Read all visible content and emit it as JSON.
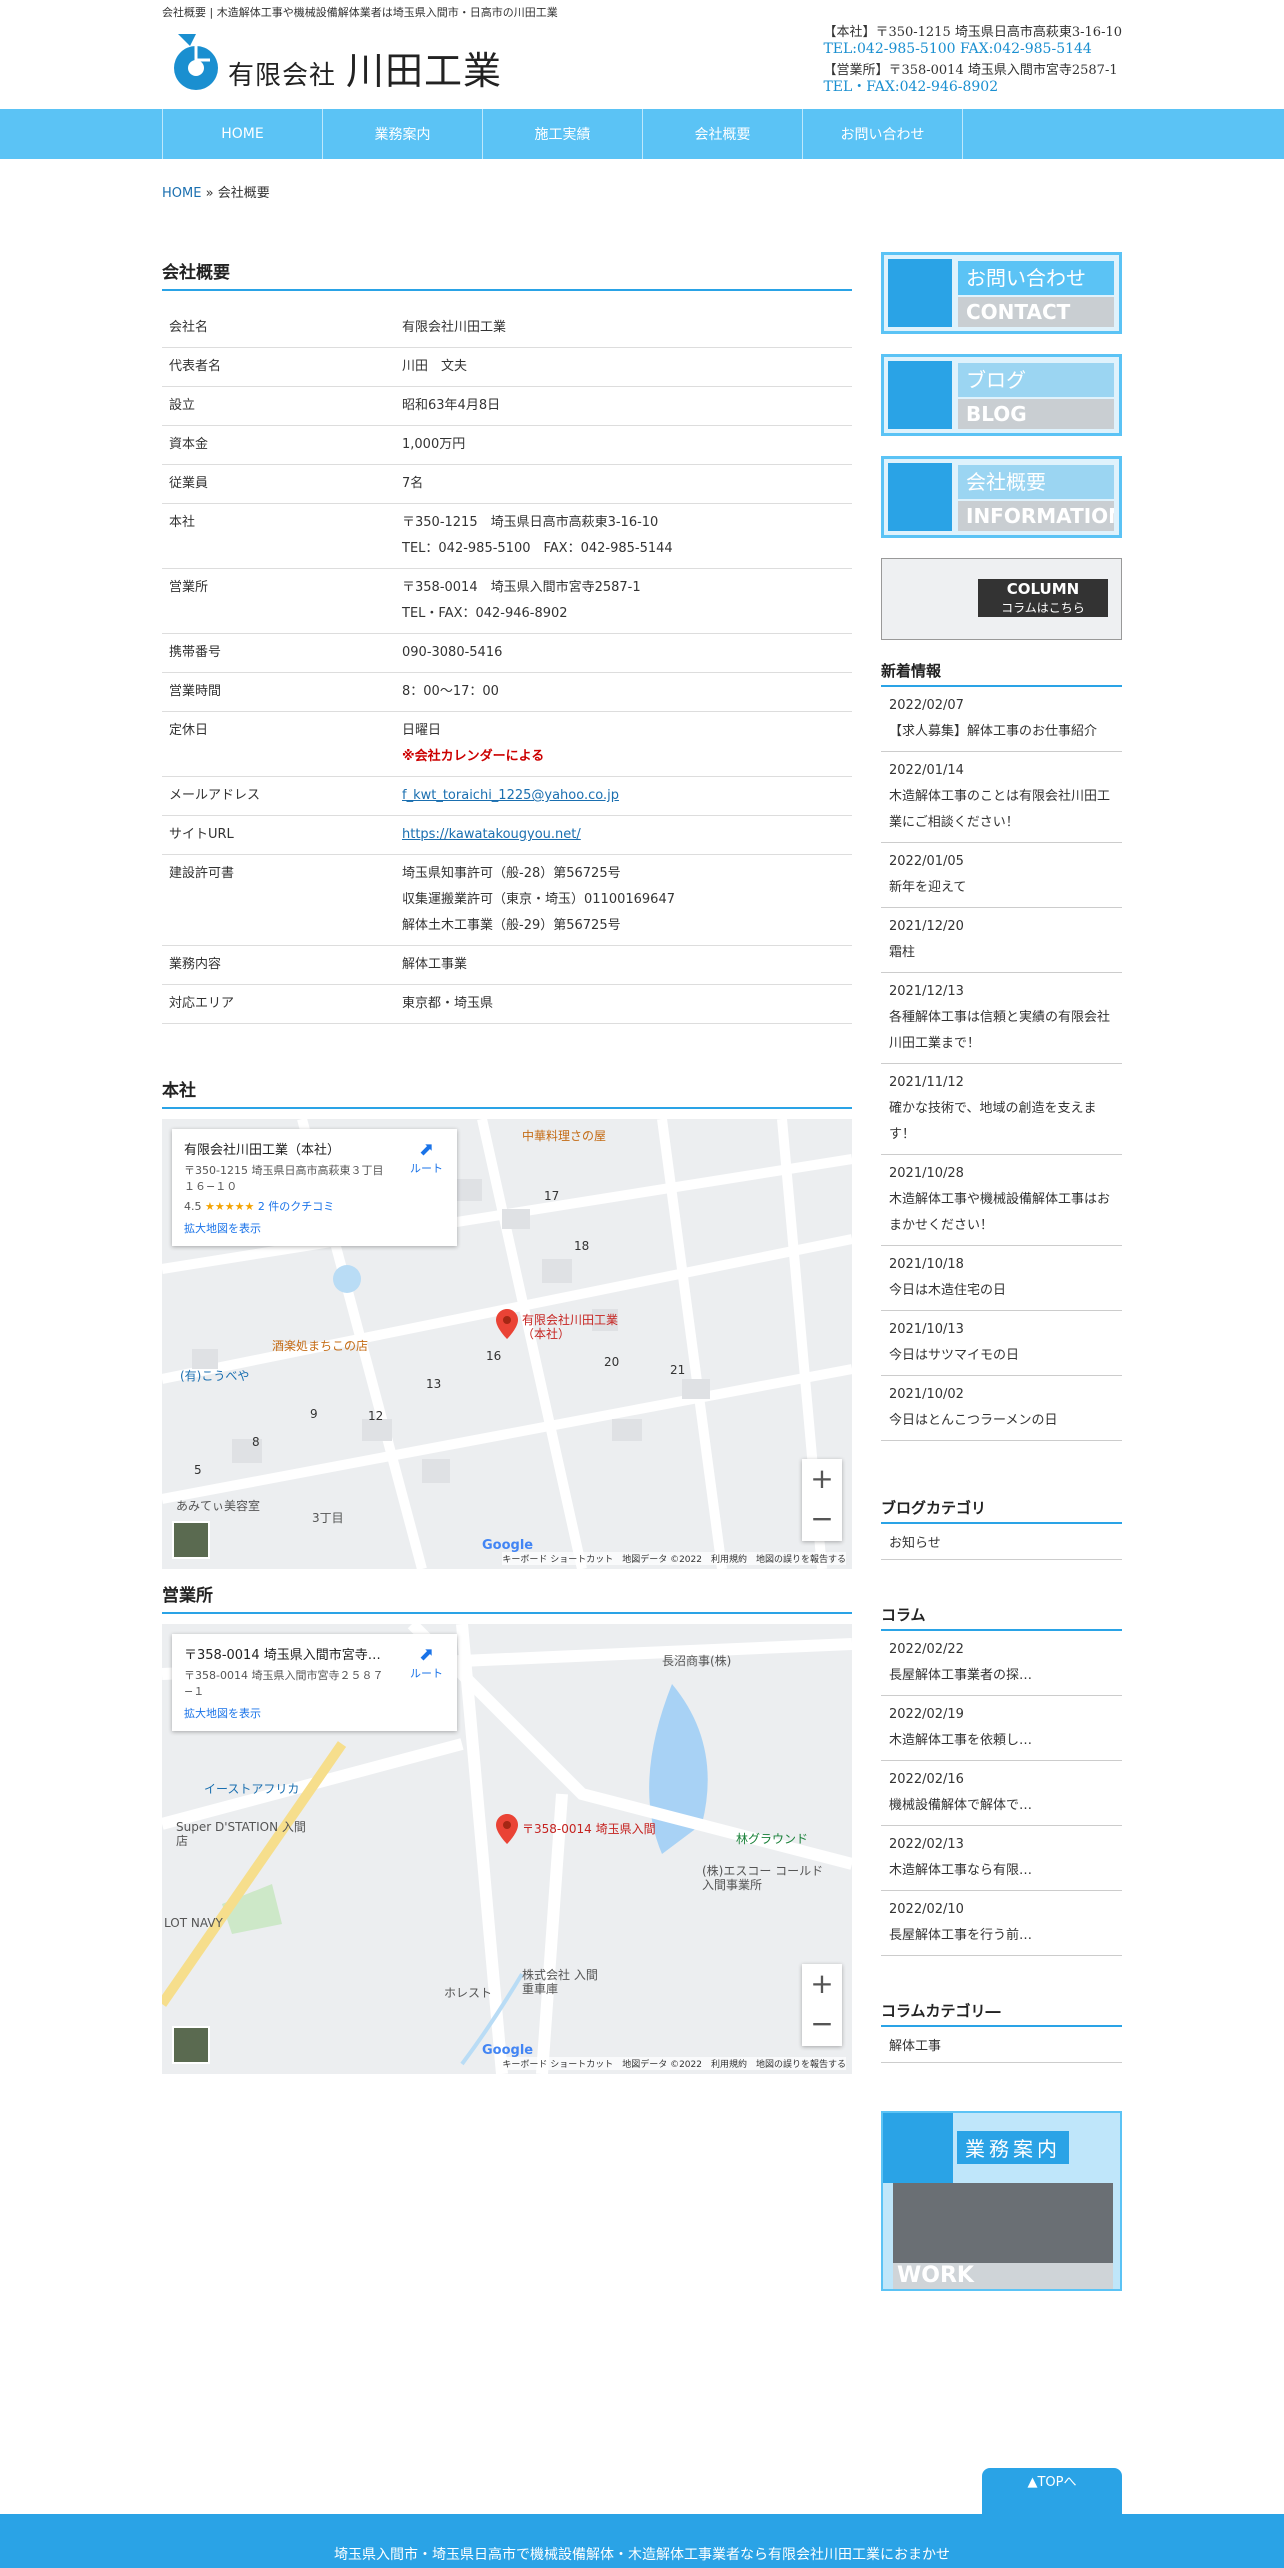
{
  "header": {
    "tagline": "会社概要 | 木造解体工事や機械設備解体業者は埼玉県入間市・日高市の川田工業",
    "logo_prefix": "有限会社",
    "logo_name": "川田工業",
    "hq_address": "【本社】〒350-1215 埼玉県日高市高萩東3-16-10",
    "hq_tel": "TEL:042-985-5100  FAX:042-985-5144",
    "office_address": "【営業所】〒358-0014 埼玉県入間市宮寺2587-1",
    "office_tel": "TEL・FAX:042-946-8902"
  },
  "nav": [
    "HOME",
    "業務案内",
    "施工実績",
    "会社概要",
    "お問い合わせ"
  ],
  "breadcrumb": {
    "home": "HOME",
    "sep": "»",
    "current": "会社概要"
  },
  "main": {
    "title": "会社概要",
    "rows": [
      {
        "k": "会社名",
        "v": [
          "有限会社川田工業"
        ]
      },
      {
        "k": "代表者名",
        "v": [
          "川田　文夫"
        ]
      },
      {
        "k": "設立",
        "v": [
          "昭和63年4月8日"
        ]
      },
      {
        "k": "資本金",
        "v": [
          "1,000万円"
        ]
      },
      {
        "k": "従業員",
        "v": [
          "7名"
        ]
      },
      {
        "k": "本社",
        "v": [
          "〒350-1215　埼玉県日高市高萩東3-16-10",
          "TEL：042-985-5100　FAX：042-985-5144"
        ]
      },
      {
        "k": "営業所",
        "v": [
          "〒358-0014　埼玉県入間市宮寺2587-1",
          "TEL・FAX：042-946-8902"
        ]
      },
      {
        "k": "携帯番号",
        "v": [
          "090-3080-5416"
        ]
      },
      {
        "k": "営業時間",
        "v": [
          "8：00～17：00"
        ]
      },
      {
        "k": "定休日",
        "v": [
          "日曜日"
        ],
        "note": "※会社カレンダーによる"
      },
      {
        "k": "メールアドレス",
        "v": [
          "f_kwt_toraichi_1225@yahoo.co.jp"
        ],
        "link": true
      },
      {
        "k": "サイトURL",
        "v": [
          "https://kawatakougyou.net/"
        ],
        "link": true
      },
      {
        "k": "建設許可書",
        "v": [
          "埼玉県知事許可（般-28）第56725号",
          "収集運搬業許可（東京・埼玉）01100169647",
          "解体土木工事業（般-29）第56725号"
        ]
      },
      {
        "k": "業務内容",
        "v": [
          "解体工事業"
        ]
      },
      {
        "k": "対応エリア",
        "v": [
          "東京都・埼玉県"
        ]
      }
    ],
    "map1": {
      "title": "本社",
      "card_title": "有限会社川田工業（本社）",
      "card_addr": "〒350-1215 埼玉県日高市高萩東３丁目１６−１０",
      "rating": "4.5",
      "stars": "★★★★★",
      "reviews": "2 件のクチコミ",
      "enlarge": "拡大地図を表示",
      "route": "ルート",
      "pin_label": "有限会社川田工業（本社）",
      "places": [
        "中華料理さの屋",
        "(有)こうべや",
        "酒楽処まちこの店",
        "あみてぃ美容室",
        "3丁目"
      ],
      "blocks": [
        "17",
        "18",
        "16",
        "20",
        "21",
        "13",
        "12",
        "9",
        "8",
        "5"
      ],
      "footer": "キーボード ショートカット　地図データ ©2022　利用規約　地図の誤りを報告する",
      "google": "Google"
    },
    "map2": {
      "title": "営業所",
      "card_title": "〒358-0014 埼玉県入間市宮寺…",
      "card_addr": "〒358-0014 埼玉県入間市宮寺２５８７−１",
      "enlarge": "拡大地図を表示",
      "route": "ルート",
      "pin_label": "〒358-0014 埼玉県入間",
      "places": [
        "長沼商事(株)",
        "イーストアフリカ",
        "Super D'STATION 入間店",
        "(株)エスコー コールド 入間事業所",
        "林グラウンド",
        "株式会社 入間重車庫",
        "ホレスト",
        "LOT NAVY"
      ],
      "footer": "キーボード ショートカット　地図データ ©2022　利用規約　地図の誤りを報告する",
      "google": "Google"
    }
  },
  "sidebar": {
    "banners": [
      {
        "jp": "お問い合わせ",
        "en": "CONTACT"
      },
      {
        "jp": "ブログ",
        "en": "BLOG"
      },
      {
        "jp": "会社概要",
        "en": "INFORMATION"
      },
      {
        "jp": "コラムはこちら",
        "en": "COLUMN"
      }
    ],
    "news_title": "新着情報",
    "news": [
      {
        "date": "2022/02/07",
        "text": "【求人募集】解体工事のお仕事紹介"
      },
      {
        "date": "2022/01/14",
        "text": "木造解体工事のことは有限会社川田工業にご相談ください！"
      },
      {
        "date": "2022/01/05",
        "text": "新年を迎えて"
      },
      {
        "date": "2021/12/20",
        "text": "霜柱"
      },
      {
        "date": "2021/12/13",
        "text": "各種解体工事は信頼と実績の有限会社川田工業まで！"
      },
      {
        "date": "2021/11/12",
        "text": "確かな技術で、地域の創造を支えます！"
      },
      {
        "date": "2021/10/28",
        "text": "木造解体工事や機械設備解体工事はおまかせください！"
      },
      {
        "date": "2021/10/18",
        "text": "今日は木造住宅の日"
      },
      {
        "date": "2021/10/13",
        "text": "今日はサツマイモの日"
      },
      {
        "date": "2021/10/02",
        "text": "今日はとんこつラーメンの日"
      }
    ],
    "blogcat_title": "ブログカテゴリ",
    "blogcat": [
      "お知らせ"
    ],
    "column_title": "コラム",
    "column": [
      {
        "date": "2022/02/22",
        "text": "長屋解体工事業者の探…"
      },
      {
        "date": "2022/02/19",
        "text": "木造解体工事を依頼し…"
      },
      {
        "date": "2022/02/16",
        "text": "機械設備解体で解体で…"
      },
      {
        "date": "2022/02/13",
        "text": "木造解体工事なら有限…"
      },
      {
        "date": "2022/02/10",
        "text": "長屋解体工事を行う前…"
      }
    ],
    "colcat_title": "コラムカテゴリ―",
    "colcat": [
      "解体工事"
    ],
    "work_banner": {
      "jp": "業務案内",
      "en": "WORK"
    }
  },
  "totop": "▲TOPへ",
  "footer": "埼玉県入間市・埼玉県日高市で機械設備解体・木造解体工事業者なら有限会社川田工業におまかせ",
  "colors": {
    "accent": "#2aa3e6",
    "nav": "#5bc3f5",
    "red": "#cc0000"
  }
}
